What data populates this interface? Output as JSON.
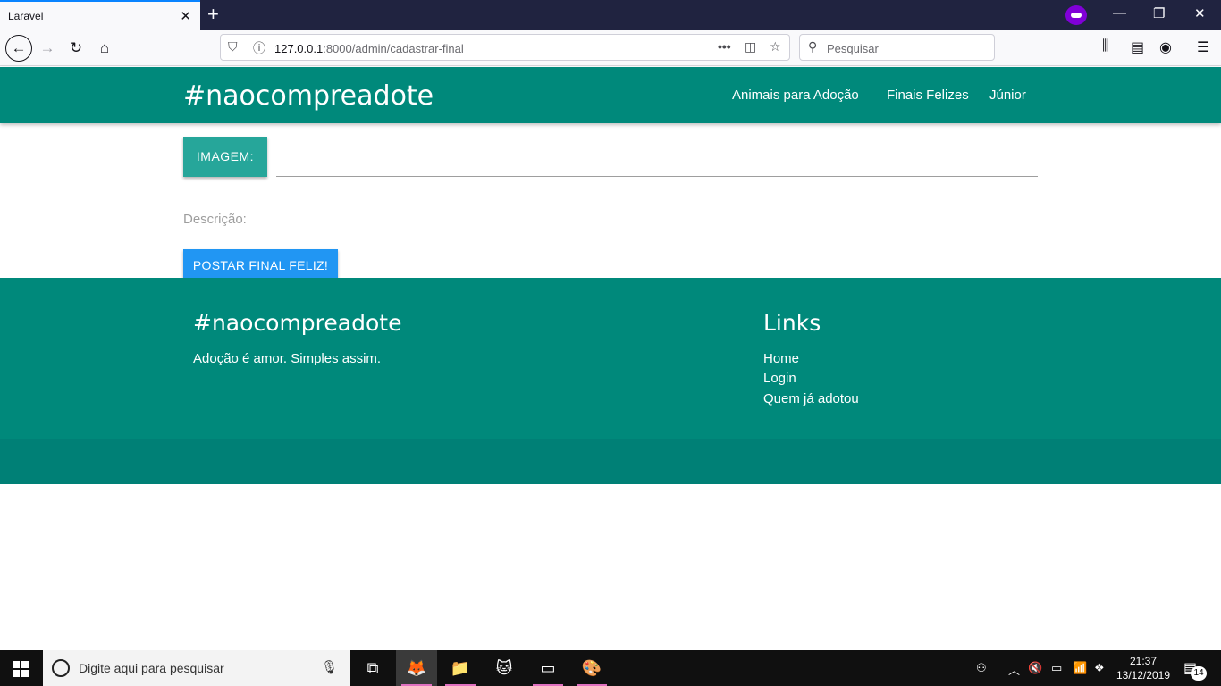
{
  "browser": {
    "tab_title": "Laravel",
    "url_host": "127.0.0.1",
    "url_rest": ":8000/admin/cadastrar-final",
    "search_placeholder": "Pesquisar"
  },
  "header": {
    "brand": "#naocompreadote",
    "menu": [
      "Animais para Adoção",
      "Finais Felizes",
      "Júnior"
    ]
  },
  "form": {
    "file_button_label": "IMAGEM:",
    "description_label": "Descrição:",
    "submit_label": "POSTAR FINAL FELIZ!"
  },
  "footer": {
    "title": "#naocompreadote",
    "tagline": "Adoção é amor. Simples assim.",
    "links_title": "Links",
    "links": [
      "Home",
      "Login",
      "Quem já adotou"
    ]
  },
  "taskbar": {
    "search_placeholder": "Digite aqui para pesquisar",
    "time": "21:37",
    "date": "13/12/2019",
    "notifications": "14"
  },
  "colors": {
    "primary": "#00897b",
    "file_button": "#26a69a",
    "submit_button": "#2196f3"
  }
}
